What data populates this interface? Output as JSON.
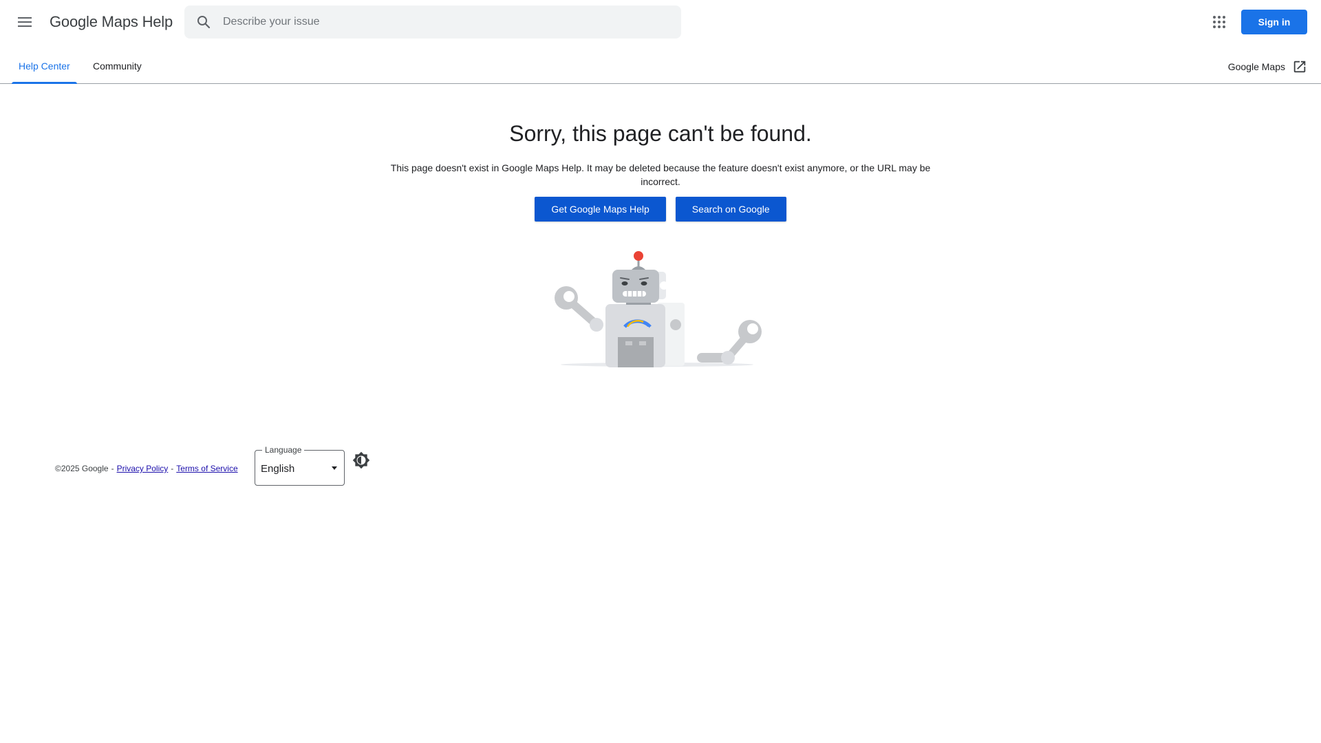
{
  "header": {
    "app_title": "Google Maps Help",
    "search_placeholder": "Describe your issue",
    "search_value": "",
    "sign_in_label": "Sign in",
    "menu_icon": "hamburger-menu-icon",
    "apps_icon": "google-apps-grid-icon"
  },
  "tabs": [
    {
      "label": "Help Center",
      "active": true
    },
    {
      "label": "Community",
      "active": false
    }
  ],
  "external_link": {
    "label": "Google Maps",
    "icon": "open-in-new-icon"
  },
  "main": {
    "title": "Sorry, this page can't be found.",
    "description": "This page doesn't exist in Google Maps Help. It may be deleted because the feature doesn't exist anymore, or the URL may be incorrect.",
    "primary_button": "Get Google Maps Help",
    "secondary_button": "Search on Google",
    "illustration": "broken-robot-illustration"
  },
  "footer": {
    "copyright": "©2025 Google",
    "separator": "-",
    "privacy_link": "Privacy Policy",
    "terms_link": "Terms of Service",
    "language_label": "Language",
    "language_value": "English",
    "theme_icon": "brightness-toggle-icon"
  },
  "colors": {
    "accent": "#1a73e8",
    "button_primary": "#0b57d0",
    "link": "#1a0dab",
    "search_bg": "#f1f3f4"
  }
}
